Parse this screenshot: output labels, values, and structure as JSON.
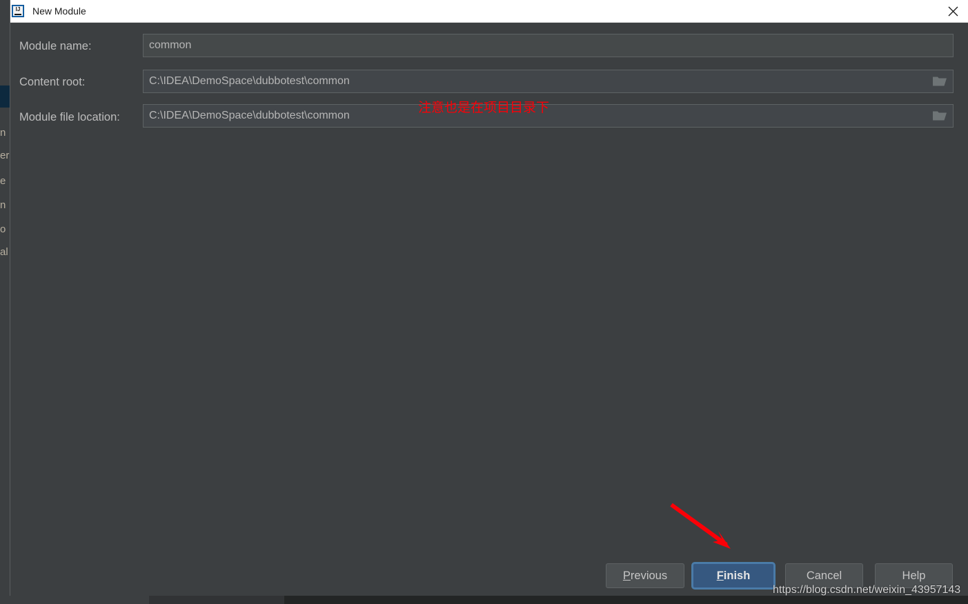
{
  "window": {
    "title": "New Module",
    "app_icon": "intellij-idea-icon",
    "close_label": "×"
  },
  "form": {
    "fields": [
      {
        "label": "Module name:",
        "value": "common",
        "has_browse": false,
        "browse_icon": "folder-icon"
      },
      {
        "label": "Content root:",
        "value": "C:\\IDEA\\DemoSpace\\dubbotest\\common",
        "has_browse": true,
        "browse_icon": "folder-icon"
      },
      {
        "label": "Module file location:",
        "value": "C:\\IDEA\\DemoSpace\\dubbotest\\common",
        "has_browse": true,
        "browse_icon": "folder-icon"
      }
    ]
  },
  "annotation": {
    "text": "注意也是在项目目录下",
    "color": "#fb0007",
    "arrow": "red-arrow-pointing-to-finish"
  },
  "footer": {
    "buttons": [
      {
        "label": "Previous",
        "mnemonic": "P",
        "default": false
      },
      {
        "label": "Finish",
        "mnemonic": "F",
        "default": true
      },
      {
        "label": "Cancel",
        "mnemonic": "",
        "default": false
      },
      {
        "label": "Help",
        "mnemonic": "",
        "default": false
      }
    ]
  },
  "watermark": {
    "text": "https://blog.csdn.net/weixin_43957143"
  },
  "background": {
    "fragments": [
      "n",
      "er",
      "e",
      "n",
      "o",
      "al"
    ]
  },
  "colors": {
    "dialog_bg": "#3c3f41",
    "field_bg": "#45494a",
    "accent": "#365880",
    "annotation_red": "#fb0007",
    "titlebar_bg": "#ffffff"
  }
}
